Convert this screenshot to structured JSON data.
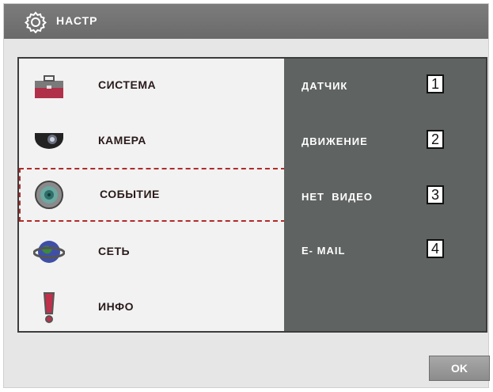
{
  "header": {
    "title": "НАСТР",
    "icon": "gear-icon"
  },
  "menu": {
    "items": [
      {
        "label": "СИСТЕМА",
        "icon": "toolbox-icon"
      },
      {
        "label": "КАМЕРА",
        "icon": "camera-icon"
      },
      {
        "label": "СОБЫТИЕ",
        "icon": "event-icon",
        "selected": true
      },
      {
        "label": "СЕТЬ",
        "icon": "network-globe-icon"
      },
      {
        "label": "ИНФО",
        "icon": "exclamation-icon"
      }
    ]
  },
  "submenu": {
    "items": [
      {
        "label": "ДАТЧИК",
        "number": "1"
      },
      {
        "label": "ДВИЖЕНИЕ",
        "number": "2"
      },
      {
        "label": "НЕТ  ВИДЕО",
        "number": "3"
      },
      {
        "label": "E- MAIL",
        "number": "4"
      }
    ]
  },
  "footer": {
    "ok_label": "OK"
  },
  "colors": {
    "selection_border": "#b22a2a",
    "submenu_bg": "#5f6362",
    "titlebar_bg": "#727272"
  }
}
